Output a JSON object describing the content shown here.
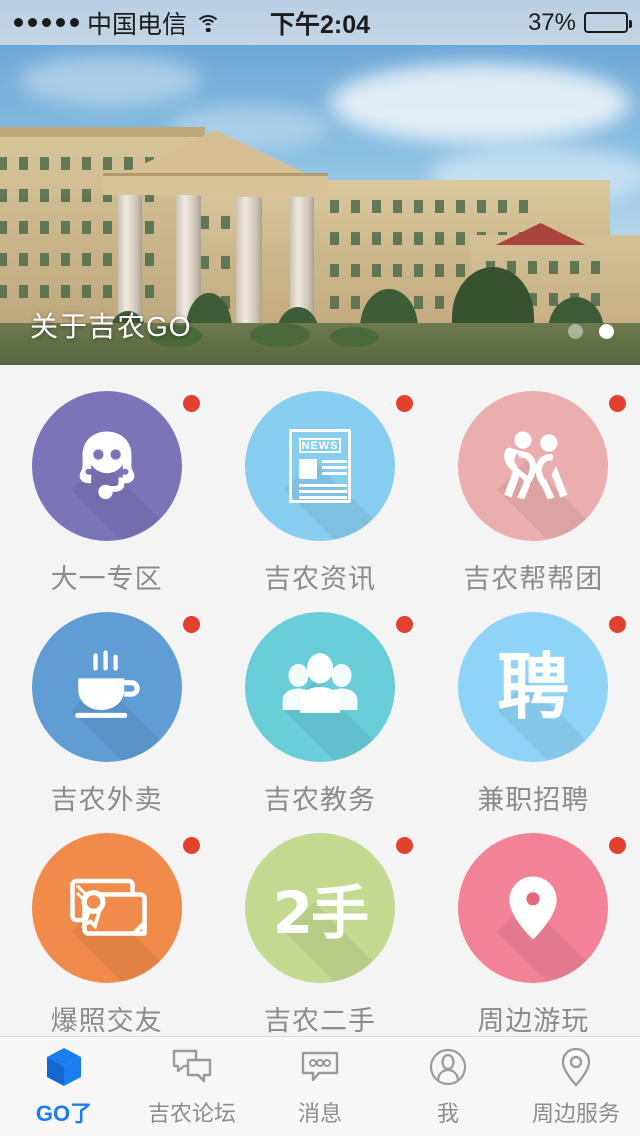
{
  "status_bar": {
    "signal_dots": 5,
    "carrier": "中国电信",
    "wifi_icon": "wifi-icon",
    "time": "下午2:04",
    "battery_percent": "37%",
    "battery_level": 37,
    "battery_color": "#f5c518"
  },
  "banner": {
    "title": "关于吉农GO",
    "page_dots": 2,
    "active_dot": 1,
    "image_alt": "campus-building-photo"
  },
  "grid": {
    "items": [
      {
        "label": "大一专区",
        "icon": "headset-support-icon",
        "color": "#7b74b8",
        "badge": true
      },
      {
        "label": "吉农资讯",
        "icon": "newspaper-news-icon",
        "color": "#87cdf0",
        "badge": true,
        "glyph_text": "NEWS"
      },
      {
        "label": "吉农帮帮团",
        "icon": "two-people-heart-icon",
        "color": "#eaaeae",
        "badge": true
      },
      {
        "label": "吉农外卖",
        "icon": "coffee-cup-icon",
        "color": "#5f9dd4",
        "badge": true
      },
      {
        "label": "吉农教务",
        "icon": "group-people-icon",
        "color": "#68cdd8",
        "badge": true
      },
      {
        "label": "兼职招聘",
        "icon": "hiring-kanji-icon",
        "color": "#8fd4f7",
        "badge": true,
        "glyph_text": "聘"
      },
      {
        "label": "爆照交友",
        "icon": "certificate-card-icon",
        "color": "#f08b4a",
        "badge": true
      },
      {
        "label": "吉农二手",
        "icon": "second-hand-icon",
        "color": "#c3da90",
        "badge": true,
        "glyph_text": "2手"
      },
      {
        "label": "周边游玩",
        "icon": "map-pin-icon",
        "color": "#f28296",
        "badge": true
      }
    ],
    "badge_color": "#e2412f",
    "label_color": "#8b8b8b"
  },
  "tab_bar": {
    "active_index": 0,
    "active_color": "#1a7ef0",
    "inactive_color": "#8c8c8c",
    "tabs": [
      {
        "label": "GO了",
        "icon": "cube-3d-icon"
      },
      {
        "label": "吉农论坛",
        "icon": "speech-bubbles-icon"
      },
      {
        "label": "消息",
        "icon": "message-dots-icon"
      },
      {
        "label": "我",
        "icon": "person-circle-icon"
      },
      {
        "label": "周边服务",
        "icon": "map-pin-outline-icon"
      }
    ]
  }
}
